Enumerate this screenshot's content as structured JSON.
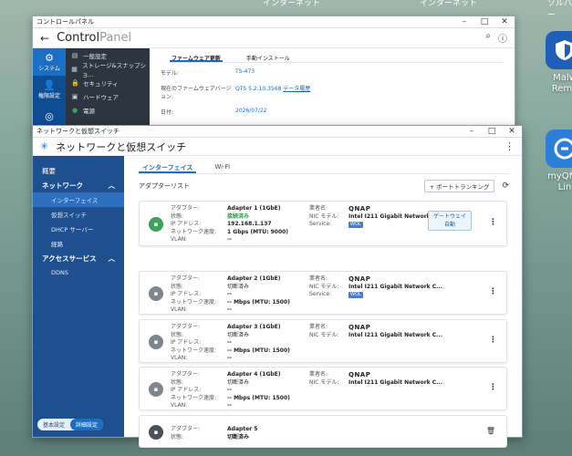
{
  "desktop": {
    "top_labels": [
      "インターネット",
      "インターネット",
      "ソルバー"
    ],
    "icons": [
      {
        "name": "Malw Remo",
        "line1": "Malw",
        "line2": "Remo"
      },
      {
        "name": "myQNAP Lin",
        "line1": "myQNA",
        "line2": "Lin"
      }
    ]
  },
  "control_panel": {
    "window_title": "コントロールパネル",
    "header_title_bold": "Control",
    "header_title_light": "Panel",
    "categories": [
      {
        "label": "システム",
        "icon": "gear-icon"
      },
      {
        "label": "権限設定",
        "icon": "user-icon"
      },
      {
        "label": "",
        "icon": "network-icon"
      }
    ],
    "menu": [
      {
        "label": "一般設定",
        "icon": "settings-icon"
      },
      {
        "label": "ストレージ&スナップショ...",
        "icon": "storage-icon"
      },
      {
        "label": "セキュリティ",
        "icon": "lock-icon"
      },
      {
        "label": "ハードウェア",
        "icon": "chip-icon"
      },
      {
        "label": "電源",
        "icon": "power-icon"
      }
    ],
    "tabs": [
      "ファームウェア更新",
      "手動インストール"
    ],
    "fields": [
      {
        "key": "モデル:",
        "value": "TS-473"
      },
      {
        "key": "現在のファームウェアバージョン:",
        "value": "QTS 5.2.10.3568",
        "link": "データ履歴"
      },
      {
        "key": "日付:",
        "value": "2026/07/22"
      }
    ]
  },
  "network": {
    "window_title": "ネットワークと仮想スイッチ",
    "header_title": "ネットワークと仮想スイッチ",
    "sidebar": {
      "overview": "概要",
      "network_section": "ネットワーク",
      "network_items": [
        "インターフェイス",
        "仮想スイッチ",
        "DHCP サーバー",
        "経路"
      ],
      "access_section": "アクセスサービス",
      "access_items": [
        "DDNS"
      ],
      "mode_basic": "基本設定",
      "mode_advanced": "詳細設定"
    },
    "tabs": [
      "インターフェイス",
      "Wi-Fi"
    ],
    "list_title": "アダプターリスト",
    "trunk_button": "+ ポートトランキング",
    "labels": {
      "adapter": "アダプター:",
      "status": "状態:",
      "ip": "IP アドレス:",
      "speed": "ネットワーク速度:",
      "vlan": "VLAN:",
      "vendor": "業者名:",
      "nic": "NIC モデル:",
      "service": "Service:"
    },
    "adapters": [
      {
        "name": "Adapter 1 (1GbE)",
        "status": "接続済み",
        "ip": "192.168.1.137",
        "speed": "1 Gbps (MTU: 9000)",
        "vlan": "--",
        "vendor": "QNAP",
        "nic": "Intel I211 Gigabit Network C...",
        "service": "WOL",
        "gateway_line1": "ゲートウェイ",
        "gateway_line2": "自動"
      },
      {
        "name": "Adapter 2 (1GbE)",
        "status": "切断済み",
        "ip": "--",
        "speed": "-- Mbps (MTU: 1500)",
        "vlan": "--",
        "vendor": "QNAP",
        "nic": "Intel I211 Gigabit Network C...",
        "service": "WOL"
      },
      {
        "name": "Adapter 3 (1GbE)",
        "status": "切断済み",
        "ip": "--",
        "speed": "-- Mbps (MTU: 1500)",
        "vlan": "--",
        "vendor": "QNAP",
        "nic": "Intel I211 Gigabit Network C..."
      },
      {
        "name": "Adapter 4 (1GbE)",
        "status": "切断済み",
        "ip": "--",
        "speed": "-- Mbps (MTU: 1500)",
        "vlan": "--",
        "vendor": "QNAP",
        "nic": "Intel I211 Gigabit Network C..."
      },
      {
        "name": "Adapter 5",
        "status": "切断済み"
      }
    ]
  }
}
